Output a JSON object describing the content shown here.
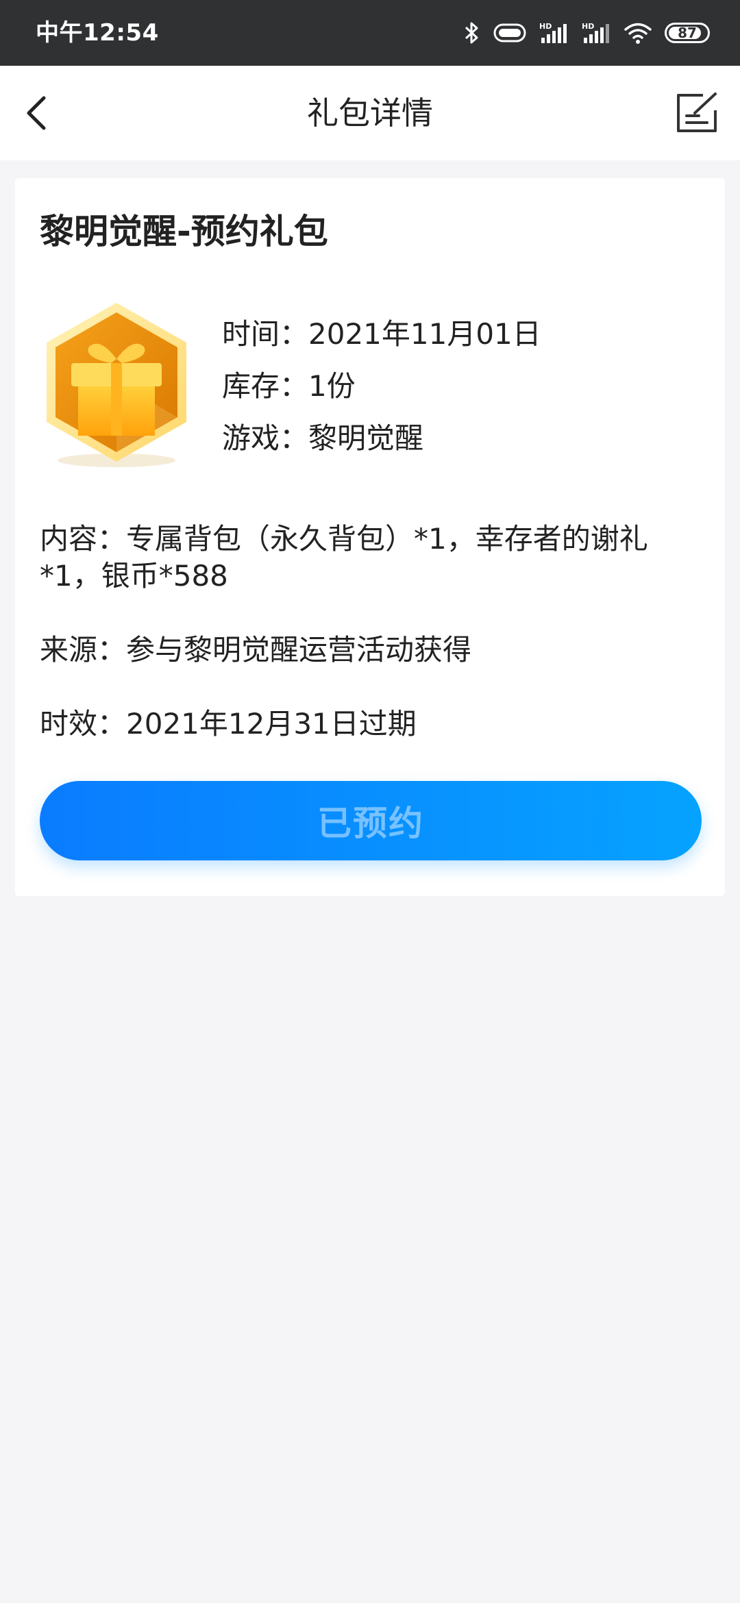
{
  "status_bar": {
    "time": "中午12:54",
    "battery_level": 87,
    "battery_label": "87",
    "icons": [
      "bluetooth-icon",
      "vibrate-icon",
      "hd-signal-icon",
      "hd-signal-icon",
      "wifi-icon",
      "battery-icon"
    ]
  },
  "header": {
    "title": "礼包详情",
    "back_icon": "chevron-left-icon",
    "edit_icon": "edit-note-icon"
  },
  "gift": {
    "title": "黎明觉醒-预约礼包",
    "icon": "gift-hexagon-icon",
    "time": "时间：2021年11月01日",
    "stock": "库存：1份",
    "game": "游戏：黎明觉醒",
    "content": "内容：专属背包（永久背包）*1，幸存者的谢礼*1，银币*588",
    "source": "来源：参与黎明觉醒运营活动获得",
    "expire": "时效：2021年12月31日过期",
    "button_label": "已预约"
  },
  "colors": {
    "status_bar_bg": "#2f3133",
    "page_bg": "#f5f5f7",
    "button_start": "#0a7cff",
    "button_end": "#06a2ff",
    "gift_gold": "#f0a800"
  }
}
